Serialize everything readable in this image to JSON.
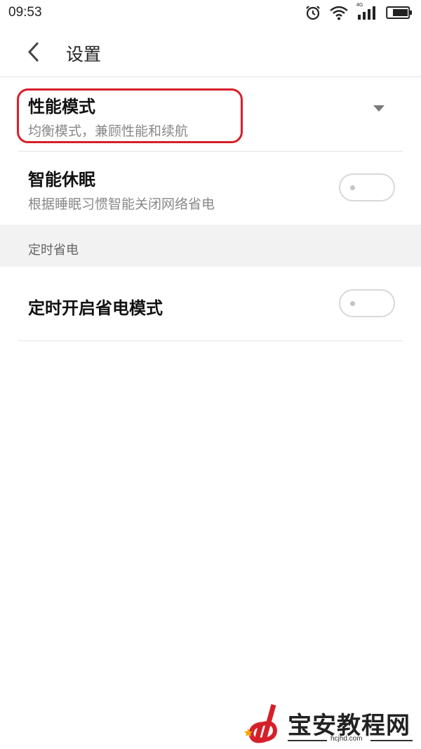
{
  "status_bar": {
    "time": "09:53",
    "network": "4G",
    "icons": [
      "alarm-icon",
      "wifi-icon",
      "signal-icon",
      "battery-icon"
    ]
  },
  "header": {
    "back_icon": "chevron-left-icon",
    "title": "设置"
  },
  "settings": {
    "performance_mode": {
      "title": "性能模式",
      "value": "均衡模式，兼顾性能和续航",
      "control": "dropdown"
    },
    "smart_sleep": {
      "title": "智能休眠",
      "description": "根据睡眠习惯智能关闭网络省电",
      "enabled": false
    }
  },
  "section": {
    "label": "定时省电"
  },
  "scheduled_saving": {
    "title": "定时开启省电模式",
    "enabled": false
  },
  "annotation": {
    "color": "#d71f2a"
  },
  "watermark": {
    "text": "宝安教程网",
    "url": "hcjhd.com",
    "logo_color": "#d71f2a"
  }
}
